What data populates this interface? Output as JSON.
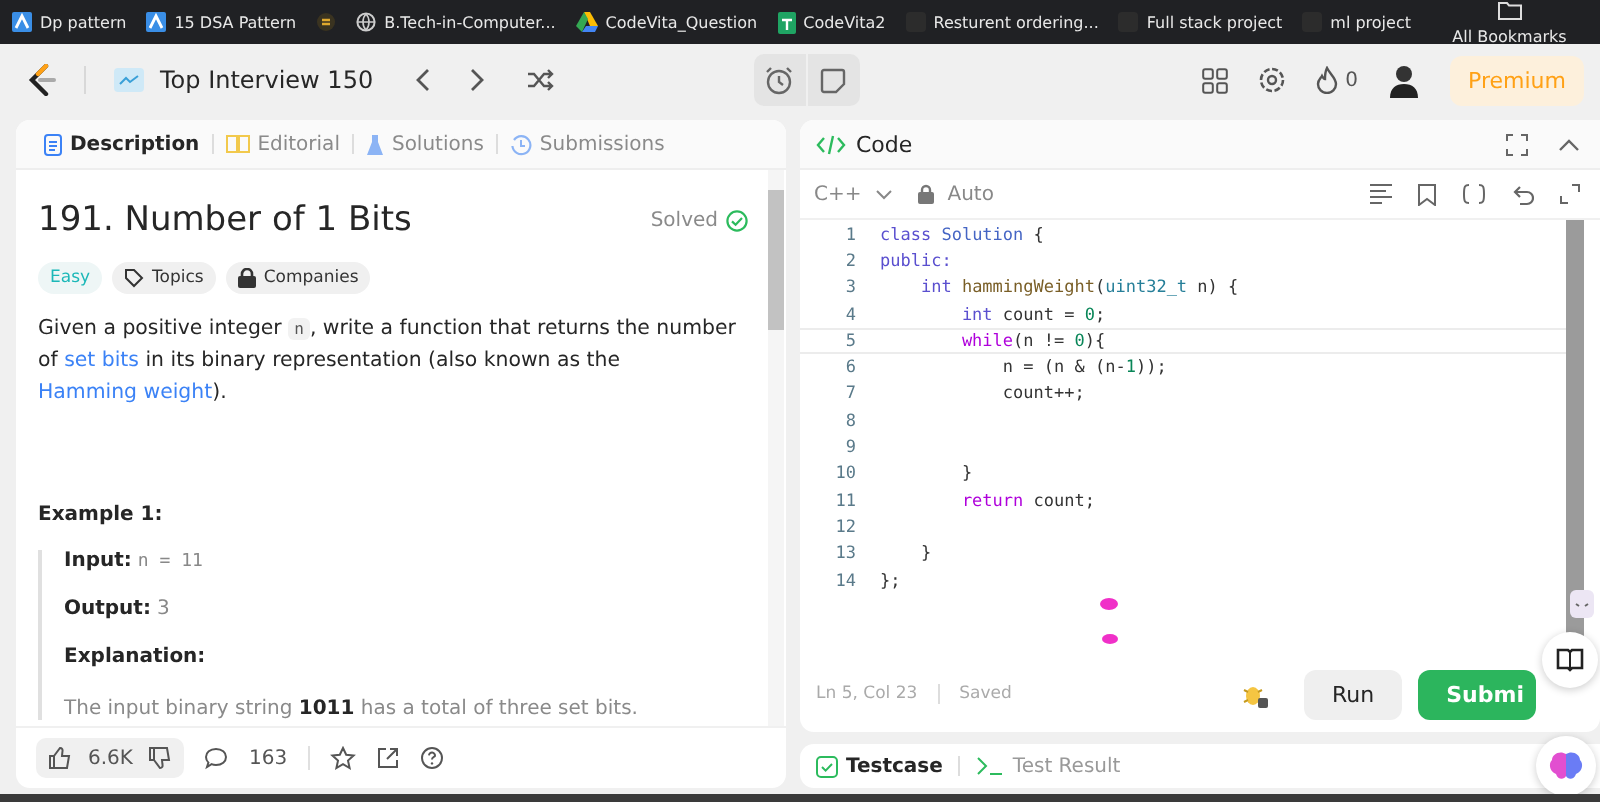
{
  "bookmarks": [
    {
      "kind": "app",
      "label": "Dp pattern"
    },
    {
      "kind": "app",
      "label": "15 DSA Pattern"
    },
    {
      "kind": "coin"
    },
    {
      "kind": "globe",
      "label": "B.Tech-in-Computer..."
    },
    {
      "kind": "drive",
      "label": "CodeVita_Question"
    },
    {
      "kind": "sheet",
      "label": "CodeVita2"
    },
    {
      "kind": "dark",
      "label": "Resturent ordering..."
    },
    {
      "kind": "dark",
      "label": "Full stack project"
    },
    {
      "kind": "dark",
      "label": "ml project"
    },
    {
      "kind": "folder",
      "label": "All Bookmarks"
    }
  ],
  "topbar": {
    "list_title": "Top Interview 150",
    "streak": "0",
    "premium": "Premium"
  },
  "left_tabs": [
    {
      "kind": "description",
      "label": "Description",
      "selected": true
    },
    {
      "kind": "editorial",
      "label": "Editorial",
      "selected": false
    },
    {
      "kind": "solutions",
      "label": "Solutions",
      "selected": false
    },
    {
      "kind": "submissions",
      "label": "Submissions",
      "selected": false
    }
  ],
  "problem": {
    "title": "191. Number of 1 Bits",
    "status": "Solved",
    "difficulty": "Easy",
    "tags": [
      {
        "kind": "topics",
        "label": "Topics"
      },
      {
        "kind": "companies",
        "label": "Companies"
      }
    ],
    "description": [
      {
        "kind": "text",
        "text": "Given a positive integer "
      },
      {
        "kind": "code",
        "text": "n"
      },
      {
        "kind": "text",
        "text": ", write a function that returns the number of "
      },
      {
        "kind": "link",
        "text": "set bits"
      },
      {
        "kind": "text",
        "text": " in its binary representation (also known as the "
      },
      {
        "kind": "link",
        "text": "Hamming weight"
      },
      {
        "kind": "text",
        "text": ")."
      }
    ],
    "example_title": "Example 1:",
    "example": [
      {
        "label": "Input:",
        "value": "n = 11",
        "mono": true
      },
      {
        "label": "Output:",
        "value": "3",
        "mono": false
      },
      {
        "label": "Explanation:"
      }
    ],
    "explanation": "The input binary string **1011** has a total of three set bits."
  },
  "footer": {
    "likes": "6.6K",
    "comments": "163"
  },
  "code_panel": {
    "title": "Code",
    "language": "C++",
    "mode": "Auto",
    "lines": [
      {
        "number": "1",
        "active": false,
        "tokens": [
          {
            "kind": "kw",
            "text": "class"
          },
          {
            "kind": "cls",
            "text": " Solution"
          },
          {
            "kind": "p",
            "text": " {"
          }
        ]
      },
      {
        "number": "2",
        "active": false,
        "tokens": [
          {
            "kind": "kw",
            "text": "public:"
          }
        ]
      },
      {
        "number": "3",
        "active": false,
        "tokens": [
          {
            "kind": "kw",
            "text": "    int"
          },
          {
            "kind": "fn",
            "text": " hammingWeight"
          },
          {
            "kind": "p",
            "text": "("
          },
          {
            "kind": "type",
            "text": "uint32_t"
          },
          {
            "kind": "p",
            "text": " n) {"
          }
        ]
      },
      {
        "number": "4",
        "active": false,
        "tokens": [
          {
            "kind": "kw",
            "text": "        int"
          },
          {
            "kind": "p",
            "text": " count = "
          },
          {
            "kind": "num",
            "text": "0"
          },
          {
            "kind": "p",
            "text": ";"
          }
        ]
      },
      {
        "number": "5",
        "active": true,
        "tokens": [
          {
            "kind": "ctrl",
            "text": "        while"
          },
          {
            "kind": "p",
            "text": "(n != "
          },
          {
            "kind": "num",
            "text": "0"
          },
          {
            "kind": "p",
            "text": "){"
          }
        ]
      },
      {
        "number": "6",
        "active": false,
        "tokens": [
          {
            "kind": "p",
            "text": "            n = (n & (n-"
          },
          {
            "kind": "num",
            "text": "1"
          },
          {
            "kind": "p",
            "text": "));"
          }
        ]
      },
      {
        "number": "7",
        "active": false,
        "tokens": [
          {
            "kind": "p",
            "text": "            count++;"
          }
        ]
      },
      {
        "number": "8",
        "active": false
      },
      {
        "number": "9",
        "active": false
      },
      {
        "number": "10",
        "active": false,
        "tokens": [
          {
            "kind": "p",
            "text": "        }"
          }
        ]
      },
      {
        "number": "11",
        "active": false,
        "tokens": [
          {
            "kind": "ctrl",
            "text": "        return"
          },
          {
            "kind": "p",
            "text": " count;"
          }
        ]
      },
      {
        "number": "12",
        "active": false
      },
      {
        "number": "13",
        "active": false,
        "tokens": [
          {
            "kind": "p",
            "text": "    }"
          }
        ]
      },
      {
        "number": "14",
        "active": false,
        "tokens": [
          {
            "kind": "p",
            "text": "};"
          }
        ]
      }
    ],
    "cursor_position": "Ln 5, Col 23",
    "save_state": "Saved",
    "run": "Run",
    "submit": "Submi"
  },
  "bottom_tabs": [
    {
      "kind": "testcase",
      "label": "Testcase",
      "selected": true
    },
    {
      "kind": "result",
      "label": "Test Result",
      "selected": false
    }
  ]
}
